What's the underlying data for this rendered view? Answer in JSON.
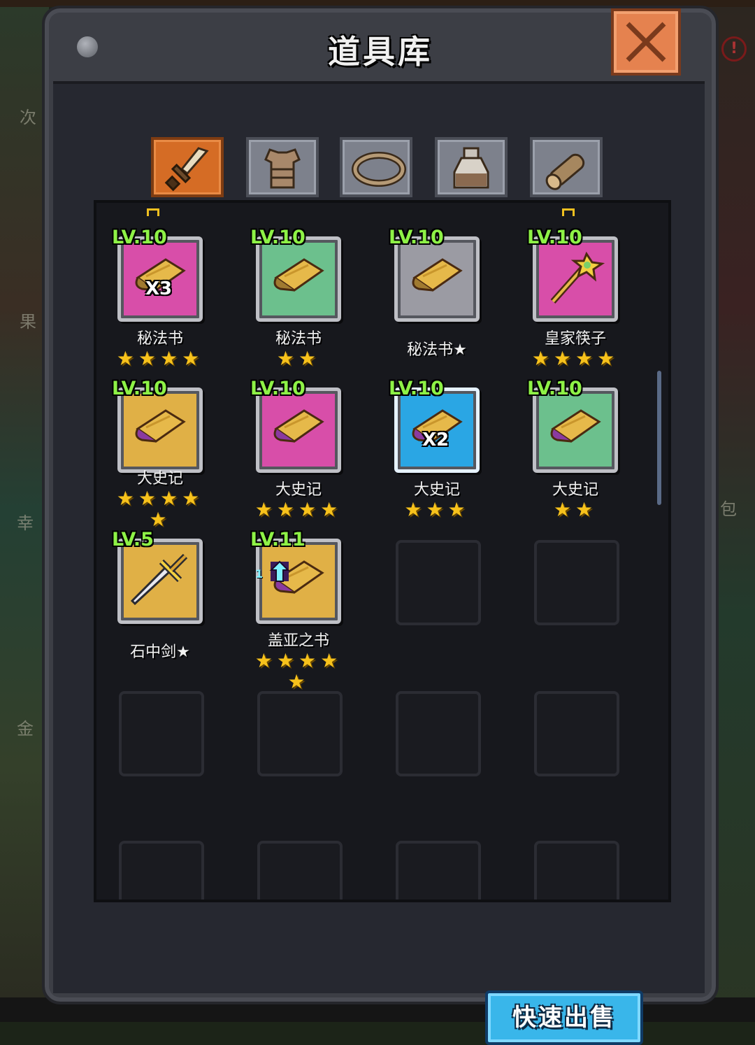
{
  "window": {
    "title": "道具库",
    "close_label": "×"
  },
  "side_glyphs": [
    "次",
    "果",
    "幸",
    "金",
    "包"
  ],
  "tabs": [
    {
      "name": "weapon",
      "icon": "sword-icon",
      "active": true
    },
    {
      "name": "armor",
      "icon": "armor-icon",
      "active": false
    },
    {
      "name": "ring",
      "icon": "ring-icon",
      "active": false
    },
    {
      "name": "potion",
      "icon": "potion-icon",
      "active": false
    },
    {
      "name": "material",
      "icon": "log-icon",
      "active": false
    }
  ],
  "items": [
    {
      "level": "LV.10",
      "name": "秘法书",
      "stars": "★★★★",
      "stars2": "",
      "qty": "X3",
      "color": "pink",
      "icon": "scroll-icon",
      "marker": true
    },
    {
      "level": "LV.10",
      "name": "秘法书",
      "stars": "★★",
      "stars2": "",
      "qty": "",
      "color": "green",
      "icon": "scroll-icon",
      "marker": false
    },
    {
      "level": "LV.10",
      "name": "秘法书★",
      "stars": "",
      "stars2": "",
      "qty": "",
      "color": "gray",
      "icon": "scroll-icon",
      "marker": false
    },
    {
      "level": "LV.10",
      "name": "皇家筷子",
      "stars": "★★★★",
      "stars2": "",
      "qty": "",
      "color": "pink",
      "icon": "scepter-icon",
      "marker": true
    },
    {
      "level": "LV.10",
      "name": "大史记",
      "stars": "★★★★",
      "stars2": "★",
      "qty": "",
      "color": "gold",
      "icon": "scroll-icon",
      "marker": false
    },
    {
      "level": "LV.10",
      "name": "大史记",
      "stars": "★★★★",
      "stars2": "",
      "qty": "",
      "color": "pink",
      "icon": "scroll-icon",
      "marker": false
    },
    {
      "level": "LV.10",
      "name": "大史记",
      "stars": "★★★",
      "stars2": "",
      "qty": "X2",
      "color": "blue",
      "icon": "scroll-icon",
      "marker": false
    },
    {
      "level": "LV.10",
      "name": "大史记",
      "stars": "★★",
      "stars2": "",
      "qty": "",
      "color": "green",
      "icon": "scroll-icon",
      "marker": false
    },
    {
      "level": "LV.5",
      "name": "石中剑★",
      "stars": "",
      "stars2": "",
      "qty": "",
      "color": "gold",
      "icon": "sword-icon",
      "marker": false
    },
    {
      "level": "LV.11",
      "name": "盖亚之书",
      "stars": "★★★★",
      "stars2": "★",
      "qty": "",
      "color": "gold",
      "icon": "scroll-icon",
      "marker": false,
      "tier": "1"
    }
  ],
  "sell_button": "快速出售",
  "colors": {
    "frame": "#3c3e45",
    "panel": "#17181d",
    "level": "#8ef246",
    "star": "#f7c21c",
    "sell": "#39b6ea",
    "close": "#e5824f"
  }
}
